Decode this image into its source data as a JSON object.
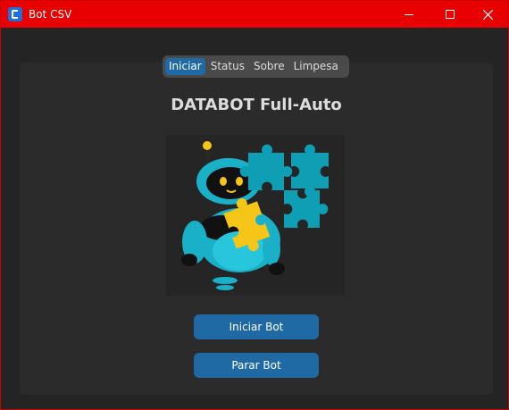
{
  "window": {
    "title": "Bot CSV"
  },
  "tabs": [
    {
      "label": "Iniciar",
      "active": true
    },
    {
      "label": "Status",
      "active": false
    },
    {
      "label": "Sobre",
      "active": false
    },
    {
      "label": "Limpesa",
      "active": false
    }
  ],
  "main": {
    "heading": "DATABOT Full-Auto",
    "illustration_icon": "robot-holding-puzzle-icon"
  },
  "buttons": {
    "start_label": "Iniciar Bot",
    "stop_label": "Parar Bot"
  },
  "colors": {
    "titlebar": "#e80000",
    "accent": "#1f6aa5",
    "background": "#242424",
    "panel": "#2b2b2b",
    "robot": "#1ab0c8",
    "puzzle_blue": "#0f9fb5",
    "puzzle_yellow": "#f5c518"
  }
}
